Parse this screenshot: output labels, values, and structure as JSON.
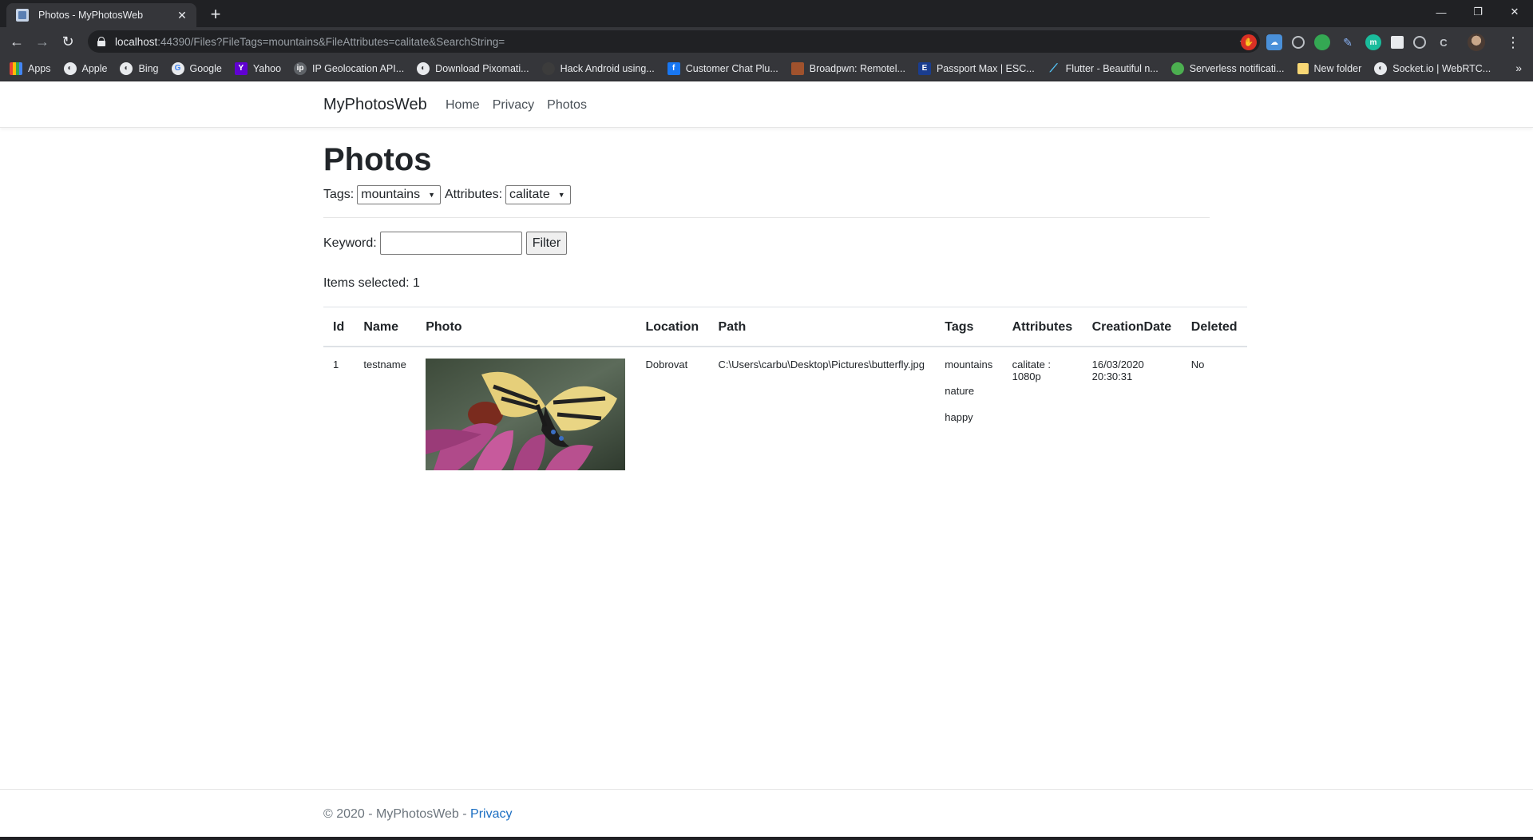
{
  "browser": {
    "tab_title": "Photos - MyPhotosWeb",
    "url_host": "localhost",
    "url_rest": ":44390/Files?FileTags=mountains&FileAttributes=calitate&SearchString=",
    "bookmarks": [
      "Apps",
      "Apple",
      "Bing",
      "Google",
      "Yahoo",
      "IP Geolocation API...",
      "Download Pixomati...",
      "Hack Android using...",
      "Customer Chat Plu...",
      "Broadpwn: Remotel...",
      "Passport Max | ESC...",
      "Flutter - Beautiful n...",
      "Serverless notificati...",
      "New folder",
      "Socket.io | WebRTC..."
    ]
  },
  "site": {
    "brand": "MyPhotosWeb",
    "nav": [
      "Home",
      "Privacy",
      "Photos"
    ]
  },
  "page": {
    "title": "Photos",
    "tags_label": "Tags:",
    "tags_value": "mountains",
    "attributes_label": "Attributes:",
    "attributes_value": "calitate",
    "keyword_label": "Keyword:",
    "keyword_value": "",
    "filter_button": "Filter",
    "items_selected": "Items selected: 1"
  },
  "table": {
    "headers": [
      "Id",
      "Name",
      "Photo",
      "Location",
      "Path",
      "Tags",
      "Attributes",
      "CreationDate",
      "Deleted"
    ],
    "rows": [
      {
        "id": "1",
        "name": "testname",
        "location": "Dobrovat",
        "path": "C:\\Users\\carbu\\Desktop\\Pictures\\butterfly.jpg",
        "tags": [
          "mountains",
          "nature",
          "happy"
        ],
        "attributes_line1": "calitate :",
        "attributes_line2": "1080p",
        "creation_date": "16/03/2020",
        "creation_time": "20:30:31",
        "deleted": "No"
      }
    ]
  },
  "footer": {
    "text": "© 2020 - MyPhotosWeb - ",
    "link": "Privacy"
  },
  "colors": {
    "chrome_dark": "#202124",
    "chrome_toolbar": "#35363a",
    "link_blue": "#1b6ec2",
    "footer_gray": "#6c757d"
  }
}
